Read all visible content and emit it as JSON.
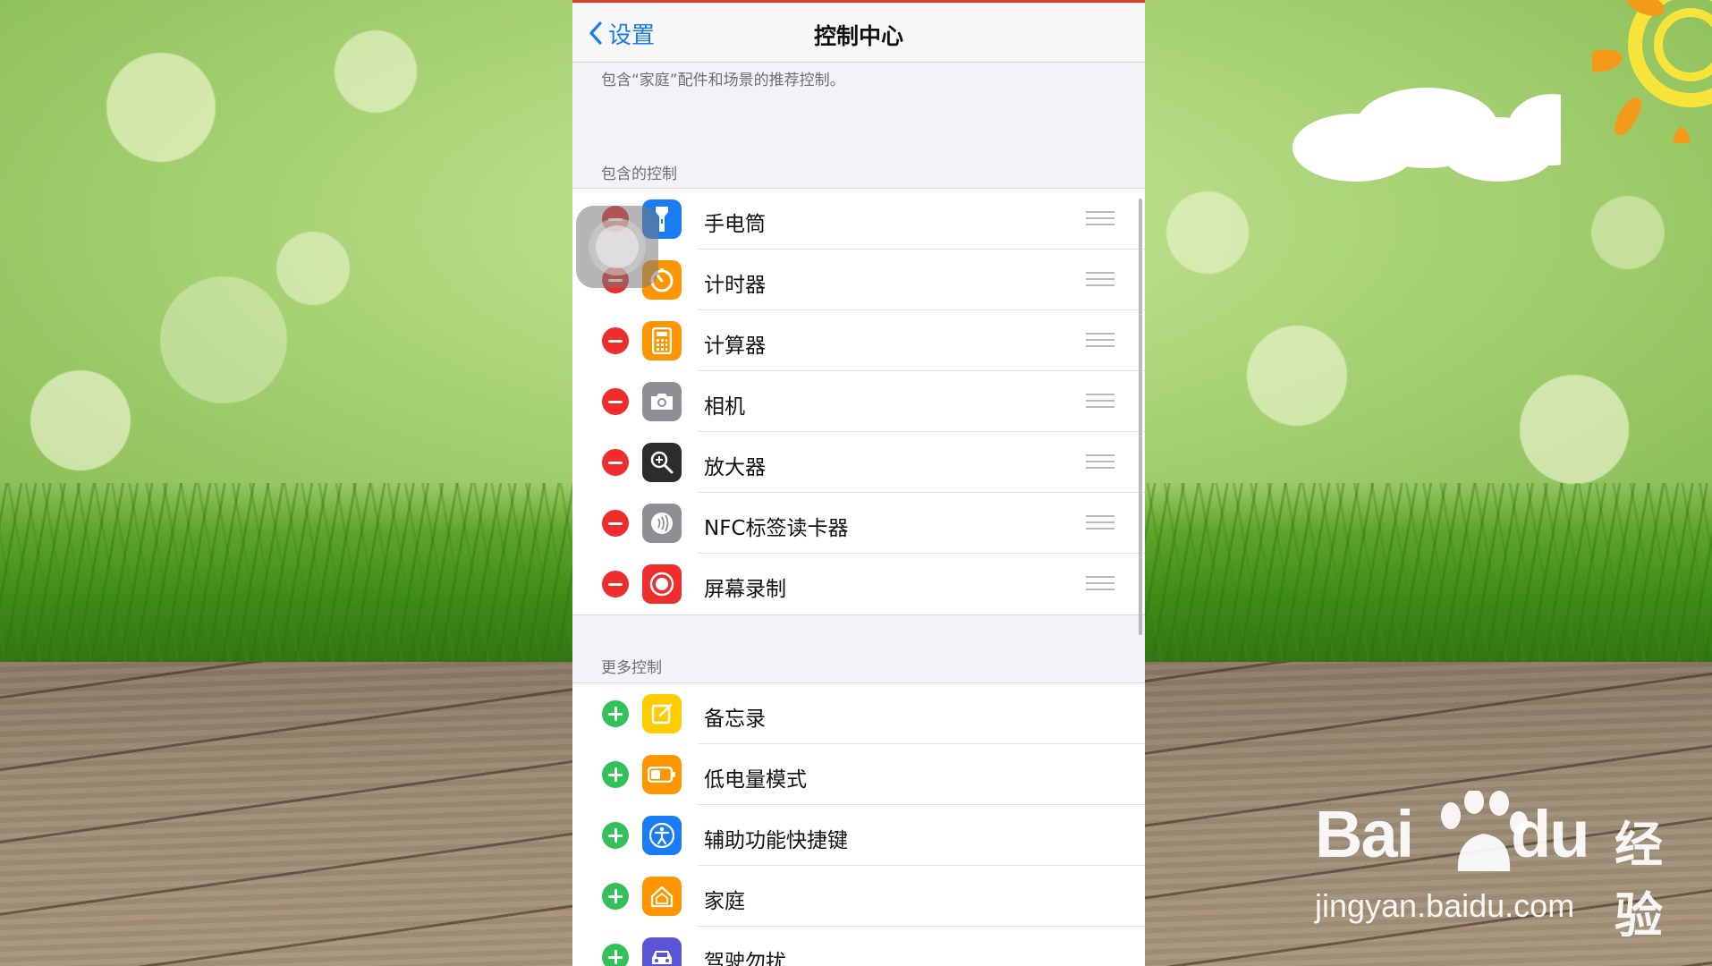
{
  "nav": {
    "back_label": "设置",
    "title": "控制中心"
  },
  "description": "包含“家庭”配件和场景的推荐控制。",
  "included": {
    "header": "包含的控制",
    "items": [
      {
        "label": "手电筒",
        "icon": "flashlight-icon",
        "color": "#1a7cf5"
      },
      {
        "label": "计时器",
        "icon": "timer-icon",
        "color": "#ff9500"
      },
      {
        "label": "计算器",
        "icon": "calculator-icon",
        "color": "#ff9500"
      },
      {
        "label": "相机",
        "icon": "camera-icon",
        "color": "#8e8e93"
      },
      {
        "label": "放大器",
        "icon": "magnifier-icon",
        "color": "#2c2c2e"
      },
      {
        "label": "NFC标签读卡器",
        "icon": "nfc-icon",
        "color": "#8e8e93"
      },
      {
        "label": "屏幕录制",
        "icon": "screen-record-icon",
        "color": "#ee2d2d"
      }
    ]
  },
  "more": {
    "header": "更多控制",
    "items": [
      {
        "label": "备忘录",
        "icon": "notes-icon",
        "color": "#ffcc00"
      },
      {
        "label": "低电量模式",
        "icon": "low-power-icon",
        "color": "#ff9500"
      },
      {
        "label": "辅助功能快捷键",
        "icon": "accessibility-icon",
        "color": "#1a7cf5"
      },
      {
        "label": "家庭",
        "icon": "home-icon",
        "color": "#ff9500"
      },
      {
        "label": "驾驶勿扰",
        "icon": "car-icon",
        "color": "#5856d6"
      }
    ]
  },
  "watermark": {
    "brand": "Bai",
    "brand_du": "du",
    "product": "经验",
    "url": "jingyan.baidu.com"
  }
}
